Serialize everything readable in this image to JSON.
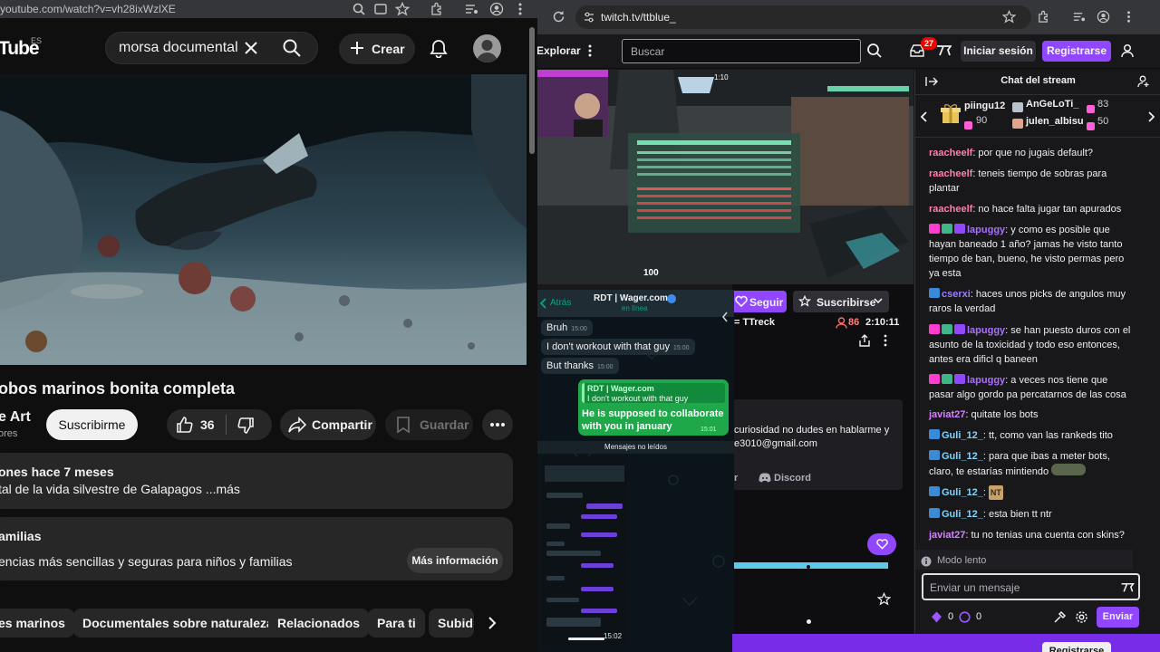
{
  "youtube": {
    "url": "youtube.com/watch?v=vh28ixWzlXE",
    "logo": "Tube",
    "logo_region": "ES",
    "search_query": "morsa documental",
    "create_label": "Crear",
    "video_title": "obos marinos bonita completa",
    "channel_name": "e Art",
    "channel_subs": "ores",
    "subscribe_label": "Suscribirme",
    "likes": "36",
    "share_label": "Compartir",
    "save_label": "Guardar",
    "desc_line1": "ones  hace 7 meses",
    "desc_line2": "tal de la vida silvestre de Galapagos ...más",
    "family_title": "amilias",
    "family_text": "encias más sencillas y seguras para niños y familias",
    "family_button": "Más información",
    "chips": [
      "es marinos",
      "Documentales sobre naturaleza",
      "Relacionados",
      "Para ti",
      "Subid"
    ]
  },
  "twitch": {
    "url": "twitch.tv/ttblue_",
    "explore_label": "Explorar",
    "search_placeholder": "Buscar",
    "notif_count": "27",
    "login_label": "Iniciar sesión",
    "register_label": "Registrarse",
    "follow_label": "Seguir",
    "subscribe_label": "Suscribirse",
    "category": "= TTreck",
    "viewers": "86",
    "uptime": "2:10:11",
    "about_line1": "curiosidad no dudes en hablarme y",
    "about_line2": "e3010@gmail.com",
    "discord_label": "Discord",
    "tw_r": "r",
    "bottom_register": "Registrarse",
    "hud_health": "100",
    "hud_timer": "1:10"
  },
  "whatsapp": {
    "back_label": "Atrás",
    "contact": "RDT | Wager.com",
    "status": "en línea",
    "msg1": "Bruh",
    "msg1_time": "15:00",
    "msg2": "I don't workout with that guy",
    "msg2_time": "15:00",
    "msg3": "But thanks",
    "msg3_time": "15:00",
    "reply_author": "RDT | Wager.com",
    "reply_quote": "I don't workout with that guy",
    "reply_text": "He is supposed to collaborate with you in january",
    "reply_time": "15:01",
    "unread_label": "Mensajes no leídos",
    "image_time": "15:02"
  },
  "chat": {
    "title": "Chat del stream",
    "gifts": [
      {
        "name": "piingu12",
        "count": "90"
      },
      {
        "name": "AnGeLoTi_",
        "count": "83"
      },
      {
        "name": "julen_albisu",
        "count": "50"
      }
    ],
    "messages": [
      {
        "user": "raacheelf",
        "text": ": por que no jugais default?",
        "color": "#ff7fae"
      },
      {
        "user": "raacheelf",
        "text": ": teneis tiempo de sobras para plantar",
        "color": "#ff7fae"
      },
      {
        "user": "raacheelf",
        "text": ": no hace falta jugar tan apurados",
        "color": "#ff7fae"
      },
      {
        "user": "lapuggy",
        "text": ": y como es posible que hayan baneado 1 año? jamas he visto tanto tiempo de ban, bueno, he visto permas pero ya esta",
        "color": "#a970ff"
      },
      {
        "user": "cserxi",
        "text": ": haces unos picks de angulos muy raros la verdad",
        "color": "#9f7cff"
      },
      {
        "user": "lapuggy",
        "text": ": se han puesto duros con el asunto de la toxicidad y todo eso entonces, antes era dificl q baneen",
        "color": "#a970ff"
      },
      {
        "user": "lapuggy",
        "text": ": a veces nos tiene que pasar algo gordo pa percatarnos de las cosa",
        "color": "#a970ff"
      },
      {
        "user": "javiat27",
        "text": ": quitate los bots",
        "color": "#d780ff"
      },
      {
        "user": "Guli_12_",
        "text": ": tt, como van las rankeds tito",
        "color": "#7fd4ff"
      },
      {
        "user": "Guli_12_",
        "text": ": para que ibas a meter bots, claro, te estarías mintiendo",
        "color": "#7fd4ff"
      },
      {
        "user": "Guli_12_",
        "text": ":",
        "color": "#7fd4ff"
      },
      {
        "user": "Guli_12_",
        "text": ": esta bien tt ntr",
        "color": "#7fd4ff"
      },
      {
        "user": "javiat27",
        "text": ": tu no tenias una cuenta con skins?",
        "color": "#d780ff"
      }
    ],
    "emote_nt": "NT",
    "slow_mode": "Modo lento",
    "input_placeholder": "Enviar un mensaje",
    "points_a": "0",
    "points_b": "0",
    "send_label": "Enviar"
  }
}
